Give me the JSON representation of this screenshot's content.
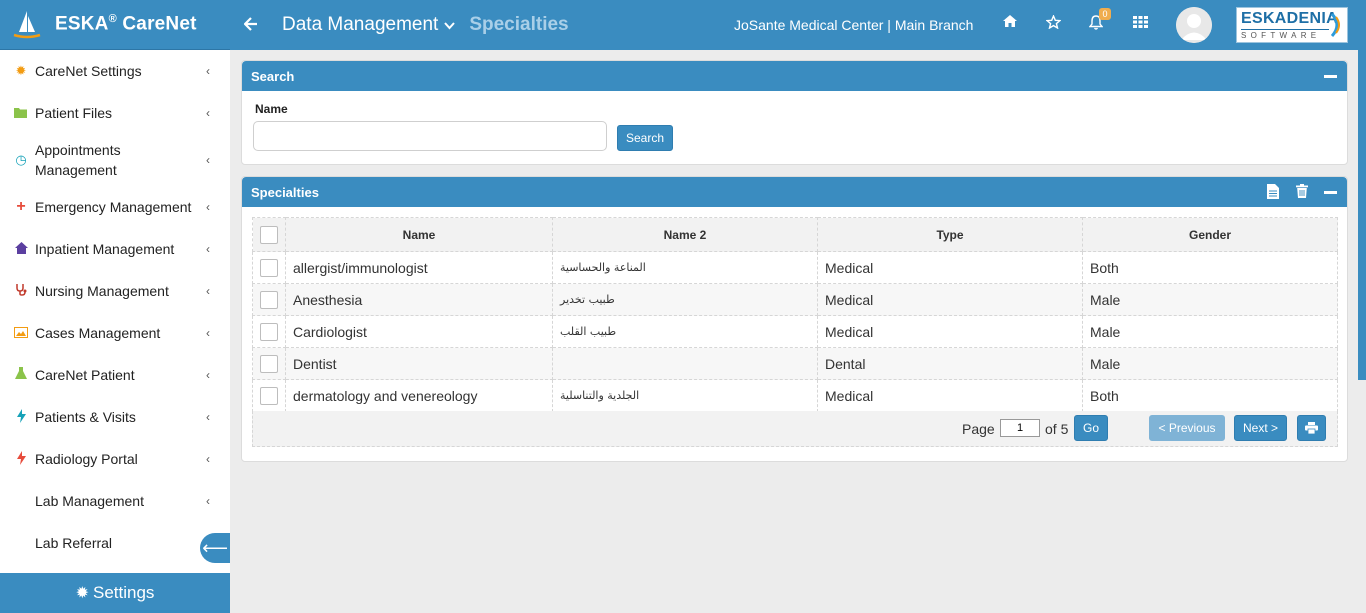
{
  "app": {
    "brand_name": "ESKA",
    "brand_reg": "®",
    "brand_suffix": " CareNet"
  },
  "header": {
    "breadcrumb_section": "Data Management",
    "breadcrumb_current": "Specialties",
    "facility": "JoSante Medical Center | Main Branch",
    "notification_count": "0",
    "company_logo_top": "ESKADENIA",
    "company_logo_bottom": "SOFTWARE"
  },
  "sidebar": {
    "items": [
      {
        "label": "CareNet Settings",
        "icon": "gear-icon",
        "color": "#f39c12"
      },
      {
        "label": "Patient Files",
        "icon": "folder-icon",
        "color": "#8bc34a"
      },
      {
        "label": "Appointments Management",
        "icon": "clock-icon",
        "color": "#17a2b8"
      },
      {
        "label": "Emergency Management",
        "icon": "plus-icon",
        "color": "#e74c3c"
      },
      {
        "label": "Inpatient Management",
        "icon": "home-icon",
        "color": "#5b3fa0"
      },
      {
        "label": "Nursing Management",
        "icon": "stethoscope-icon",
        "color": "#c0392b"
      },
      {
        "label": "Cases Management",
        "icon": "image-icon",
        "color": "#f39c12"
      },
      {
        "label": "CareNet Patient",
        "icon": "flask-icon",
        "color": "#8bc34a"
      },
      {
        "label": "Patients & Visits",
        "icon": "bolt-icon",
        "color": "#17a2b8"
      },
      {
        "label": "Radiology Portal",
        "icon": "bolt-icon",
        "color": "#e74c3c"
      },
      {
        "label": "Lab Management",
        "icon": "",
        "color": "#ffffff"
      },
      {
        "label": "Lab Referral",
        "icon": "",
        "color": "#ffffff"
      }
    ],
    "settings_label": "Settings"
  },
  "search_panel": {
    "title": "Search",
    "name_label": "Name",
    "name_value": "",
    "search_button": "Search"
  },
  "grid_panel": {
    "title": "Specialties",
    "columns": [
      "Name",
      "Name 2",
      "Type",
      "Gender"
    ],
    "rows": [
      {
        "name": "allergist/immunologist",
        "name2": "المناعة والحساسية",
        "type": "Medical",
        "gender": "Both"
      },
      {
        "name": "Anesthesia",
        "name2": "طبيب تخدير",
        "type": "Medical",
        "gender": "Male"
      },
      {
        "name": "Cardiologist",
        "name2": "طبيب القلب",
        "type": "Medical",
        "gender": "Male"
      },
      {
        "name": "Dentist",
        "name2": "",
        "type": "Dental",
        "gender": "Male"
      },
      {
        "name": "dermatology and venereology",
        "name2": "الجلدية والتناسلية",
        "type": "Medical",
        "gender": "Both"
      }
    ],
    "pager": {
      "page_label": "Page",
      "current_page": "1",
      "of_label": "of 5",
      "go_button": "Go",
      "prev_button": "< Previous",
      "next_button": "Next >"
    }
  },
  "colors": {
    "primary": "#3a8cc0",
    "badge": "#f0ad4e",
    "disabled_button": "#7fb3d6"
  }
}
